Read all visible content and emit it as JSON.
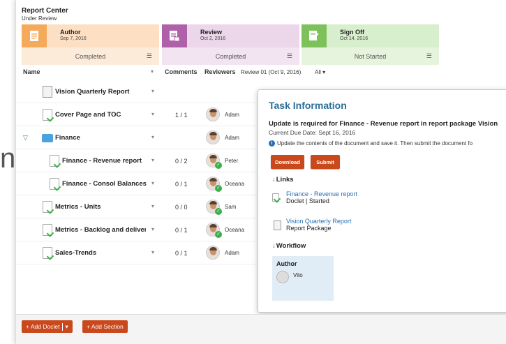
{
  "bg_char": "n",
  "header": {
    "title": "Report Center",
    "subtitle": "Under Review"
  },
  "stages": [
    {
      "name": "Author",
      "date": "Sep 7, 2016",
      "status": "Completed"
    },
    {
      "name": "Review",
      "date": "Oct 2, 2016",
      "status": "Completed"
    },
    {
      "name": "Sign Off",
      "date": "Oct 14, 2016",
      "status": "Not Started"
    }
  ],
  "columns": {
    "name": "Name",
    "comments": "Comments",
    "reviewers": "Reviewers",
    "review_cycle": "Review 01 (Oct 9, 2016)",
    "filter": "All"
  },
  "rows": [
    {
      "name": "Vision Quarterly Report",
      "count": "",
      "reviewer": ""
    },
    {
      "name": "Cover Page and TOC",
      "count": "1 / 1",
      "reviewer": "Adam"
    },
    {
      "name": "Finance",
      "count": "",
      "reviewer": "Adam"
    },
    {
      "name": "Finance - Revenue report",
      "count": "0 / 2",
      "reviewer": "Peter"
    },
    {
      "name": "Finance - Consol Balances",
      "count": "0 / 1",
      "reviewer": "Oceana"
    },
    {
      "name": "Metrics - Units",
      "count": "0 / 0",
      "reviewer": "Sam"
    },
    {
      "name": "Metrics - Backlog and delivery",
      "count": "0 / 1",
      "reviewer": "Oceana"
    },
    {
      "name": "Sales-Trends",
      "count": "0 / 1",
      "reviewer": "Adam"
    }
  ],
  "task": {
    "title": "Task Information",
    "message": "Update is required for Finance - Revenue report in report package Vision",
    "due": "Current Due Date: Sept 16, 2016",
    "info": "Update the contents of the document and save it. Then submit the document fo",
    "download_label": "Download",
    "submit_label": "Submit",
    "links_heading": "Links",
    "link1_title": "Finance - Revenue report",
    "link1_sub": "Doclet  |  Started",
    "link2_title": "Vision Quarterly Report",
    "link2_sub": "Report Package",
    "workflow_heading": "Workflow",
    "workflow_role": "Author",
    "workflow_user": "Vito"
  },
  "footer": {
    "add_doclet": "+ Add Doclet",
    "add_section": "+ Add Section"
  }
}
